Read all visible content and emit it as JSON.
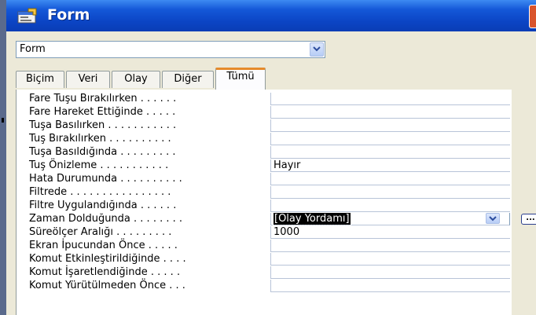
{
  "window": {
    "title": "Form"
  },
  "object_selector": {
    "value": "Form"
  },
  "tabs": [
    {
      "label": "Biçim"
    },
    {
      "label": "Veri"
    },
    {
      "label": "Olay"
    },
    {
      "label": "Diğer"
    },
    {
      "label": "Tümü",
      "active": true
    }
  ],
  "properties": [
    {
      "label": "Fare Tuşu Bırakılırken . . . . . .",
      "value": ""
    },
    {
      "label": "Fare Hareket Ettiğinde . . . . .",
      "value": ""
    },
    {
      "label": "Tuşa Basılırken . . . . . . . . . . .",
      "value": ""
    },
    {
      "label": "Tuş Bırakılırken . . . . . . . . . .",
      "value": ""
    },
    {
      "label": "Tuşa Basıldığında . . . . . . . . .",
      "value": ""
    },
    {
      "label": "Tuş Önizleme . . . . . . . . . . .",
      "value": "Hayır"
    },
    {
      "label": "Hata Durumunda . . . . . . . . . .",
      "value": ""
    },
    {
      "label": "Filtrede . . . . . . . . . . . . . . . .",
      "value": ""
    },
    {
      "label": "Filtre Uygulandığında . . . . . .",
      "value": ""
    },
    {
      "label": "Zaman Dolduğunda . . . . . . . .",
      "value": "[Olay Yordamı]",
      "selected": true
    },
    {
      "label": "Süreölçer Aralığı . . . . . . . . .",
      "value": "1000"
    },
    {
      "label": "Ekran İpucundan Önce . . . . .",
      "value": ""
    },
    {
      "label": "Komut Etkinleştirildiğinde . . . .",
      "value": ""
    },
    {
      "label": "Komut İşaretlendiğinde . . . . .",
      "value": ""
    },
    {
      "label": "Komut Yürütülmeden Önce . . .",
      "value": ""
    }
  ],
  "builder_button": {
    "label": "..."
  },
  "colors": {
    "title_bar": "#0b44c4",
    "active_tab_accent": "#e68b2c",
    "window_bg": "#ece9d8"
  }
}
